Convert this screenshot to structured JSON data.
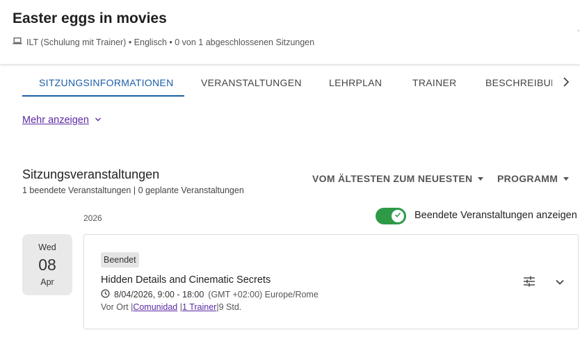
{
  "header": {
    "title": "Easter eggs in movies",
    "subtitle": "ILT (Schulung mit Trainer) • Englisch • 0 von 1 abgeschlossenen Sitzungen",
    "edge_mark": "·"
  },
  "tabs": [
    {
      "label": "SITZUNGSINFORMATIONEN",
      "active": true
    },
    {
      "label": "VERANSTALTUNGEN",
      "active": false
    },
    {
      "label": "LEHRPLAN",
      "active": false
    },
    {
      "label": "TRAINER",
      "active": false
    },
    {
      "label": "BESCHREIBUNG",
      "active": false
    }
  ],
  "more_link": {
    "label": "Mehr anzeigen"
  },
  "section": {
    "title": "Sitzungsveranstaltungen",
    "summary": "1 beendete Veranstaltungen | 0 geplante Veranstaltungen",
    "sort_label": "VOM ÄLTESTEN ZUM NEUESTEN",
    "filter_label": "PROGRAMM",
    "year": "2026",
    "toggle_label": "Beendete Veranstaltungen anzeigen",
    "toggle_on": true
  },
  "event": {
    "dow": "Wed",
    "day": "08",
    "month": "Apr",
    "status": "Beendet",
    "title": "Hidden Details and Cinematic Secrets",
    "datetime": "8/04/2026, 9:00 - 18:00",
    "timezone": "(GMT +02:00) Europe/Rome",
    "location_type": "Vor Ort |",
    "community_link": "Comunidad",
    "separator": " |",
    "trainer_link": "1 Trainer",
    "duration": "|9 Std."
  },
  "colors": {
    "accent_blue": "#1a5fa8",
    "link_purple": "#5b2aa3",
    "toggle_green": "#2e9a48"
  },
  "icons": {
    "laptop": "laptop-icon",
    "chevron_right": "chevron-right-icon",
    "chevron_down": "chevron-down-icon",
    "check": "check-icon",
    "clock": "clock-icon",
    "sliders": "sliders-icon"
  }
}
